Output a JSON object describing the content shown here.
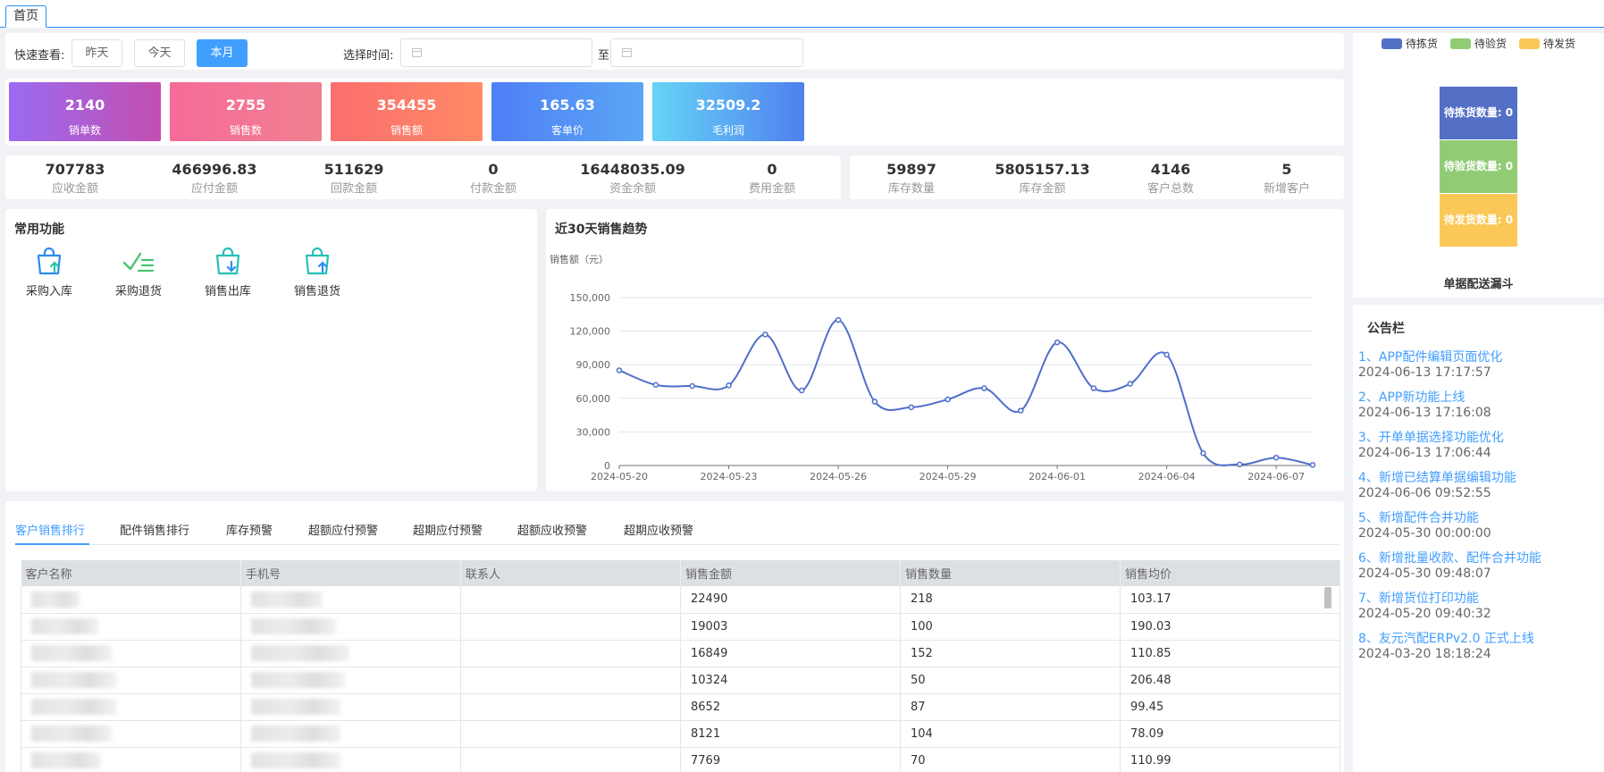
{
  "tabs": {
    "home": "首页"
  },
  "quick": {
    "label": "快速查看:",
    "yesterday": "昨天",
    "today": "今天",
    "month": "本月",
    "time_label": "选择时间:",
    "to": "至"
  },
  "cards": [
    {
      "value": "2140",
      "label": "销单数",
      "colors": [
        "#9b6bf2",
        "#c24fb0"
      ]
    },
    {
      "value": "2755",
      "label": "销售数",
      "colors": [
        "#f66b99",
        "#f08090"
      ]
    },
    {
      "value": "354455",
      "label": "销售额",
      "colors": [
        "#fb6e6e",
        "#ff8a65"
      ]
    },
    {
      "value": "165.63",
      "label": "客单价",
      "colors": [
        "#4f7ff6",
        "#5aa6f5"
      ]
    },
    {
      "value": "32509.2",
      "label": "毛利润",
      "colors": [
        "#66d4f7",
        "#4f80ee"
      ]
    }
  ],
  "finance": [
    {
      "value": "707783",
      "label": "应收金额"
    },
    {
      "value": "466996.83",
      "label": "应付金额"
    },
    {
      "value": "511629",
      "label": "回款金额"
    },
    {
      "value": "0",
      "label": "付款金额"
    },
    {
      "value": "16448035.09",
      "label": "资金余额"
    },
    {
      "value": "0",
      "label": "费用金额"
    }
  ],
  "inventory": [
    {
      "value": "59897",
      "label": "库存数量"
    },
    {
      "value": "5805157.13",
      "label": "库存金额"
    },
    {
      "value": "4146",
      "label": "客户总数"
    },
    {
      "value": "5",
      "label": "新增客户"
    }
  ],
  "functions": {
    "title": "常用功能",
    "items": [
      {
        "label": "采购入库",
        "icon": "bag-upload-icon"
      },
      {
        "label": "采购退货",
        "icon": "check-list-icon"
      },
      {
        "label": "销售出库",
        "icon": "bag-download-icon"
      },
      {
        "label": "销售退货",
        "icon": "bag-return-icon"
      }
    ]
  },
  "chart_data": {
    "type": "line",
    "title": "近30天销售趋势",
    "ylabel": "销售额（元）",
    "xlabel": "",
    "ylim": [
      0,
      150000
    ],
    "yticks": [
      "0",
      "30,000",
      "60,000",
      "90,000",
      "120,000",
      "150,000"
    ],
    "x_tick_labels": [
      "2024-05-20",
      "2024-05-23",
      "2024-05-26",
      "2024-05-29",
      "2024-06-01",
      "2024-06-04",
      "2024-06-07"
    ],
    "x": [
      "2024-05-20",
      "2024-05-21",
      "2024-05-22",
      "2024-05-23",
      "2024-05-24",
      "2024-05-25",
      "2024-05-26",
      "2024-05-27",
      "2024-05-28",
      "2024-05-29",
      "2024-05-30",
      "2024-05-31",
      "2024-06-01",
      "2024-06-02",
      "2024-06-03",
      "2024-06-04",
      "2024-06-05",
      "2024-06-06",
      "2024-06-07",
      "2024-06-08"
    ],
    "values": [
      85000,
      72000,
      71000,
      71500,
      117000,
      67000,
      130000,
      57000,
      52000,
      59000,
      69000,
      49000,
      110000,
      69000,
      73000,
      99000,
      11000,
      1000,
      7000,
      500
    ],
    "color": "#4e6fca",
    "grid": true
  },
  "rank_tabs": [
    "客户销售排行",
    "配件销售排行",
    "库存预警",
    "超额应付预警",
    "超期应付预警",
    "超额应收预警",
    "超期应收预警"
  ],
  "table": {
    "headers": [
      "客户名称",
      "手机号",
      "联系人",
      "销售金额",
      "销售数量",
      "销售均价"
    ],
    "rows": [
      [
        "22490",
        "218",
        "103.17"
      ],
      [
        "19003",
        "100",
        "190.03"
      ],
      [
        "16849",
        "152",
        "110.85"
      ],
      [
        "10324",
        "50",
        "206.48"
      ],
      [
        "8652",
        "87",
        "99.45"
      ],
      [
        "8121",
        "104",
        "78.09"
      ],
      [
        "7769",
        "70",
        "110.99"
      ]
    ]
  },
  "funnel": {
    "title": "单据配送漏斗",
    "legend": [
      {
        "label": "待拣货",
        "color": "#5470c6"
      },
      {
        "label": "待验货",
        "color": "#91cc75"
      },
      {
        "label": "待发货",
        "color": "#fac858"
      }
    ],
    "bars": [
      {
        "label": "待拣货数量: 0",
        "color": "#5470c6"
      },
      {
        "label": "待验货数量: 0",
        "color": "#91cc75"
      },
      {
        "label": "待发货数量: 0",
        "color": "#fac858"
      }
    ]
  },
  "notices": {
    "title": "公告栏",
    "items": [
      {
        "title": "1、APP配件编辑页面优化",
        "time": "2024-06-13 17:17:57"
      },
      {
        "title": "2、APP新功能上线",
        "time": "2024-06-13 17:16:08"
      },
      {
        "title": "3、开单单据选择功能优化",
        "time": "2024-06-13 17:06:44"
      },
      {
        "title": "4、新增已结算单据编辑功能",
        "time": "2024-06-06 09:52:55"
      },
      {
        "title": "5、新增配件合并功能",
        "time": "2024-05-30 00:00:00"
      },
      {
        "title": "6、新增批量收款、配件合并功能",
        "time": "2024-05-30 09:48:07"
      },
      {
        "title": "7、新增货位打印功能",
        "time": "2024-05-20 09:40:32"
      },
      {
        "title": "8、友元汽配ERPv2.0 正式上线",
        "time": "2024-03-20 18:18:24"
      }
    ]
  }
}
